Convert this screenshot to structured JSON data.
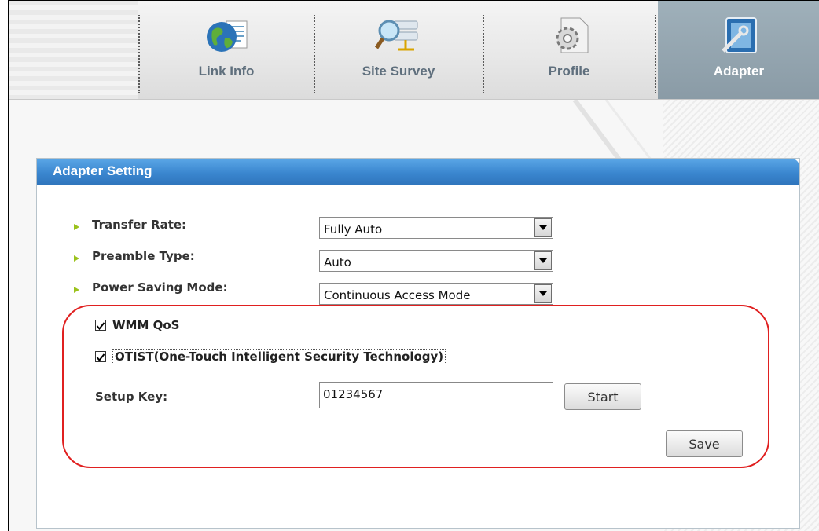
{
  "nav": {
    "tabs": [
      {
        "label": "Link Info",
        "icon": "globe-document-icon",
        "active": false
      },
      {
        "label": "Site Survey",
        "icon": "network-search-icon",
        "active": false
      },
      {
        "label": "Profile",
        "icon": "gear-document-icon",
        "active": false
      },
      {
        "label": "Adapter",
        "icon": "adapter-settings-icon",
        "active": true
      }
    ]
  },
  "panel": {
    "title": "Adapter Setting",
    "transfer_rate": {
      "label": "Transfer Rate:",
      "value": "Fully Auto"
    },
    "preamble_type": {
      "label": "Preamble Type:",
      "value": "Auto"
    },
    "power_saving": {
      "label": "Power Saving Mode:",
      "value": "Continuous Access Mode"
    },
    "wmm_qos": {
      "label": "WMM QoS",
      "checked": true
    },
    "otist": {
      "label": "OTIST(One-Touch Intelligent Security Technology)",
      "checked": true
    },
    "setup_key": {
      "label": "Setup Key:",
      "value": "01234567"
    },
    "start_label": "Start",
    "save_label": "Save"
  },
  "colors": {
    "header_blue": "#3a86cf",
    "active_tab": "#8a9ba6",
    "highlight_red": "#e02020",
    "bullet_green": "#9bc21c"
  }
}
